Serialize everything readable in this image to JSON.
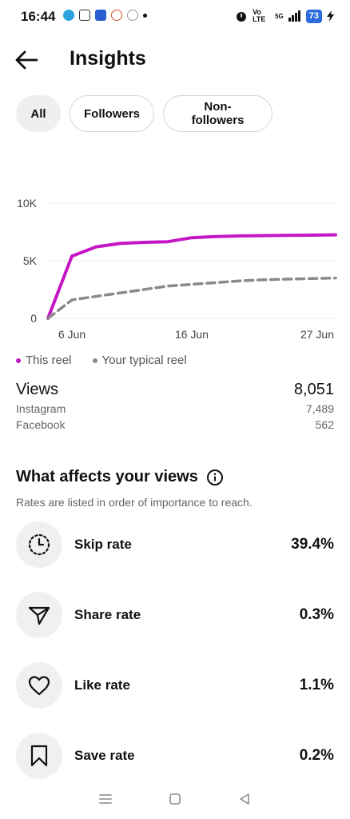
{
  "status_bar": {
    "time": "16:44",
    "network": "Vo LTE",
    "signal": "5G",
    "battery": "73",
    "colors": {
      "telegram": "#2aa3de",
      "accent": "#2b6bdc"
    }
  },
  "header": {
    "title": "Insights"
  },
  "filters": [
    {
      "label": "All",
      "active": true
    },
    {
      "label": "Followers",
      "active": false
    },
    {
      "label": "Non-followers",
      "active": false
    }
  ],
  "chart_data": {
    "type": "line",
    "y_ticks": [
      "10K",
      "5K",
      "0"
    ],
    "x_ticks": [
      "6 Jun",
      "16 Jun",
      "27 Jun"
    ],
    "ylim": [
      0,
      10000
    ],
    "x": [
      "5 Jun",
      "6 Jun",
      "8 Jun",
      "10 Jun",
      "12 Jun",
      "14 Jun",
      "16 Jun",
      "18 Jun",
      "20 Jun",
      "22 Jun",
      "24 Jun",
      "26 Jun",
      "28 Jun"
    ],
    "series": [
      {
        "name": "This reel",
        "color": "#c416c4",
        "style": "solid",
        "values": [
          0,
          5400,
          6200,
          6500,
          6600,
          6650,
          7000,
          7100,
          7150,
          7180,
          7200,
          7220,
          7250
        ]
      },
      {
        "name": "Your typical reel",
        "color": "#8a8a8a",
        "style": "dashed",
        "values": [
          0,
          1600,
          1900,
          2200,
          2500,
          2800,
          2950,
          3100,
          3250,
          3350,
          3400,
          3450,
          3500
        ]
      }
    ],
    "grid": true,
    "legend": "bottom-left"
  },
  "views": {
    "label": "Views",
    "total": "8,051",
    "breakdown": [
      {
        "label": "Instagram",
        "value": "7,489"
      },
      {
        "label": "Facebook",
        "value": "562"
      }
    ]
  },
  "affects": {
    "title": "What affects your views",
    "subtitle": "Rates are listed in order of importance to reach.",
    "metrics": [
      {
        "label": "Skip rate",
        "value": "39.4%",
        "icon": "skip-timer-icon"
      },
      {
        "label": "Share rate",
        "value": "0.3%",
        "icon": "share-arrow-icon"
      },
      {
        "label": "Like rate",
        "value": "1.1%",
        "icon": "heart-icon"
      },
      {
        "label": "Save rate",
        "value": "0.2%",
        "icon": "bookmark-icon"
      }
    ]
  }
}
